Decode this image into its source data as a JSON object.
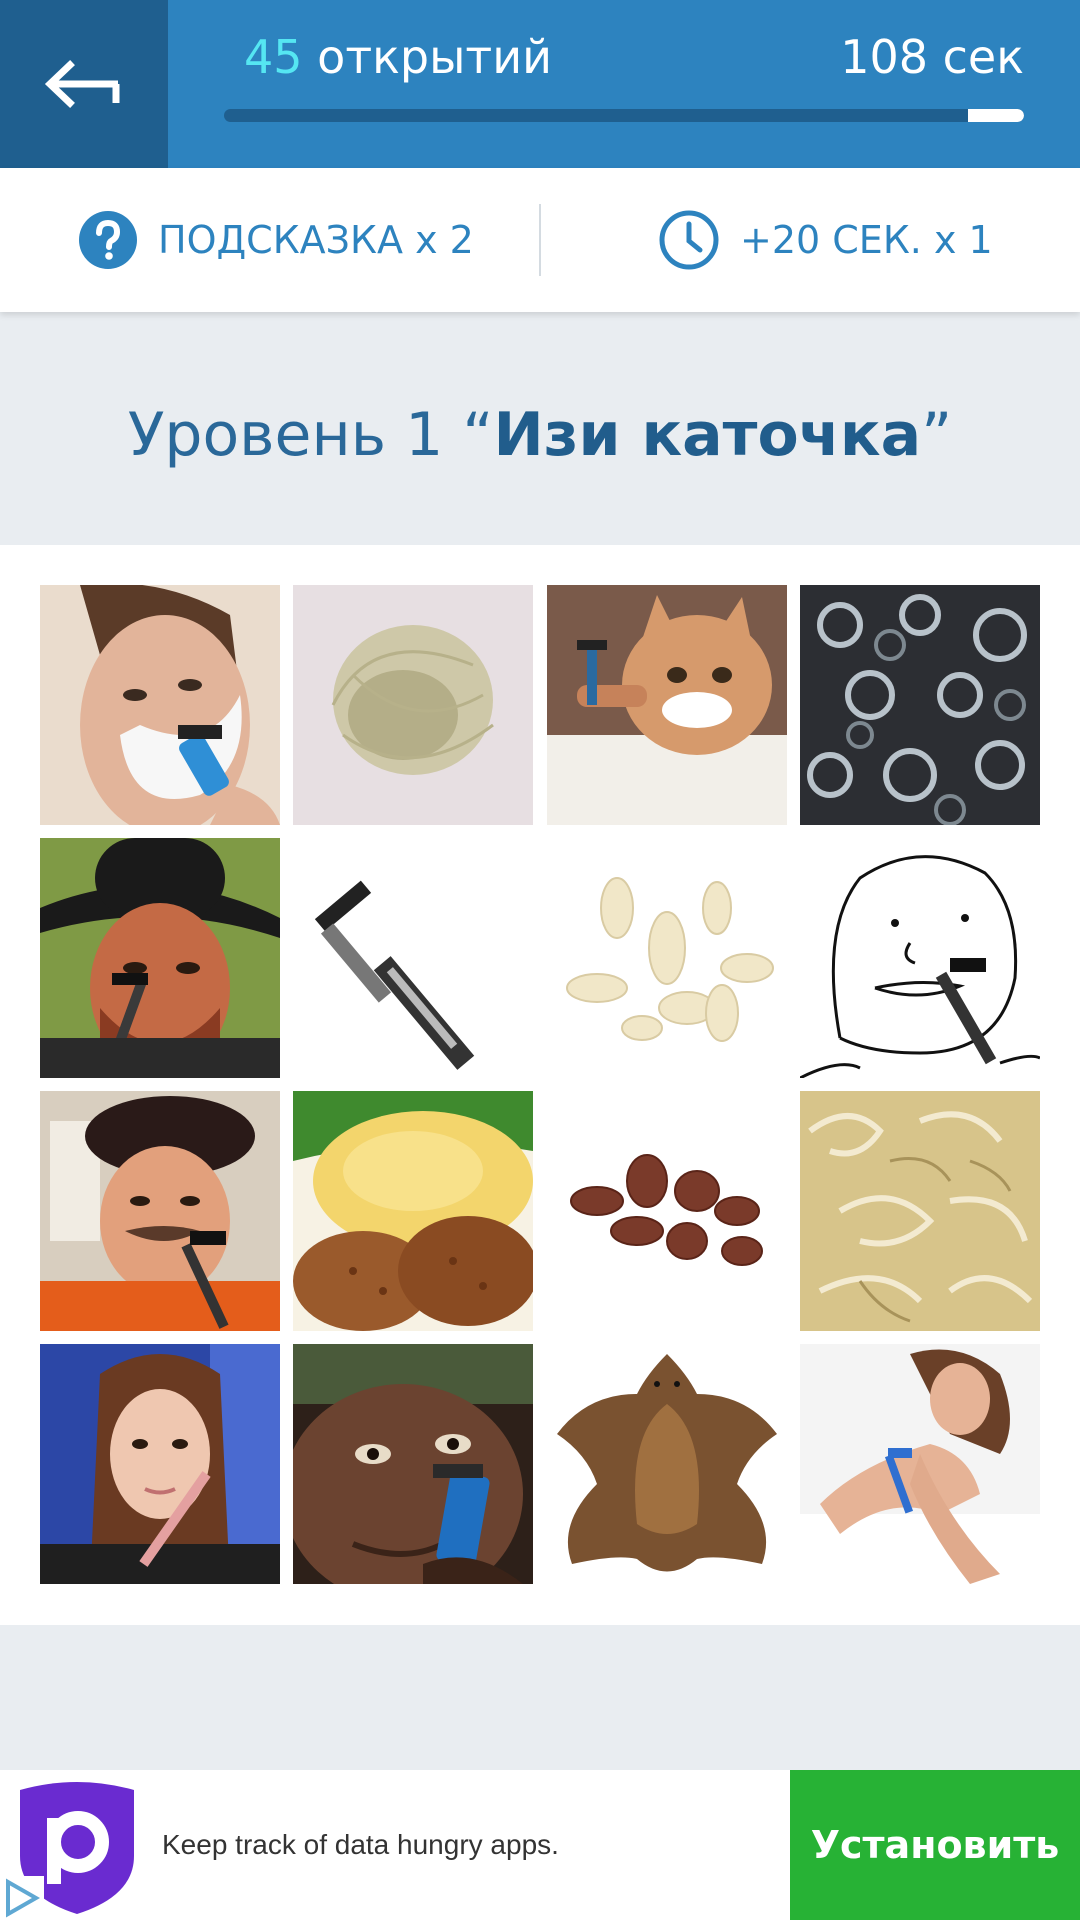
{
  "header": {
    "back_icon": "arrow-left-icon",
    "openings_count": "45",
    "openings_label": "открытий",
    "time_remaining": "108 сек",
    "time_progress_remaining": 0.07
  },
  "hints": {
    "hint_icon": "question-circle-icon",
    "hint_label": "ПОДСКАЗКА x 2",
    "time_icon": "clock-icon",
    "time_label": "+20 СЕК. x 1"
  },
  "level": {
    "prefix": "Уровень 1 “",
    "name": "Изи каточка",
    "suffix": "”"
  },
  "grid": {
    "tiles": [
      {
        "id": 1,
        "subject": "man-shaving-photo",
        "bg": "#e8d8c8"
      },
      {
        "id": 2,
        "subject": "hair-clump-photo",
        "bg": "#e6dfe1"
      },
      {
        "id": 3,
        "subject": "cat-shaving-photo",
        "bg": "#c99f86"
      },
      {
        "id": 4,
        "subject": "metal-shavings-photo",
        "bg": "#3a3c40"
      },
      {
        "id": 5,
        "subject": "cowboy-shaving-photo",
        "bg": "#6b8a3a"
      },
      {
        "id": 6,
        "subject": "broken-razor-photo",
        "bg": "#ffffff"
      },
      {
        "id": 7,
        "subject": "white-chocolate-curls-photo",
        "bg": "#ffffff"
      },
      {
        "id": 8,
        "subject": "meme-face-shaving-drawing",
        "bg": "#ffffff"
      },
      {
        "id": 9,
        "subject": "man-in-beret-shaving-photo",
        "bg": "#d9cfc2"
      },
      {
        "id": 10,
        "subject": "mashed-potato-cutlets-photo",
        "bg": "#f2d66b"
      },
      {
        "id": 11,
        "subject": "chocolate-curls-photo",
        "bg": "#ffffff"
      },
      {
        "id": 12,
        "subject": "wood-shavings-photo",
        "bg": "#d8c88e"
      },
      {
        "id": 13,
        "subject": "girl-with-razor-photo",
        "bg": "#2f48a8"
      },
      {
        "id": 14,
        "subject": "man-shaving-closeup-photo",
        "bg": "#3b2a22"
      },
      {
        "id": 15,
        "subject": "bear-skin-rug-photo",
        "bg": "#ffffff"
      },
      {
        "id": 16,
        "subject": "woman-shaving-legs-photo",
        "bg": "#f3f3f3"
      }
    ]
  },
  "ad": {
    "logo_icon": "p-shield-logo-icon",
    "text": "Keep track of data hungry apps.",
    "install_label": "Установить",
    "adchoices_icon": "adchoices-icon"
  },
  "colors": {
    "primary": "#2d83bf",
    "primary_dark": "#1f5f8f",
    "accent": "#55e6f2",
    "install_green": "#27b235",
    "background": "#e9edf1"
  }
}
